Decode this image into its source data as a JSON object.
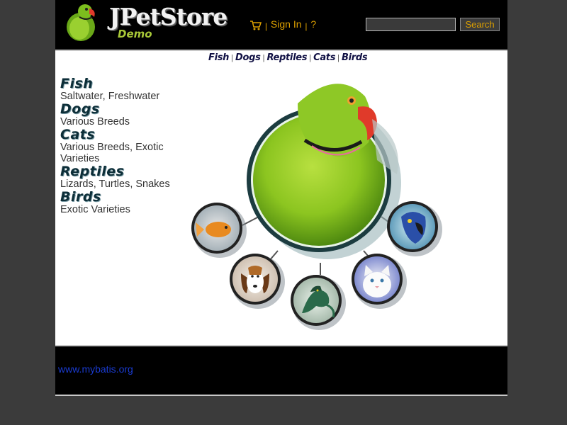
{
  "header": {
    "logo_title": "JPetStore",
    "logo_subtitle": "Demo",
    "cart_icon": "shopping-cart-icon",
    "separator": "|",
    "sign_in_label": "Sign In",
    "help_label": "?",
    "search": {
      "value": "",
      "button_label": "Search"
    },
    "colors": {
      "background": "#000000",
      "link": "#dda000"
    }
  },
  "quick_links": [
    "Fish",
    "Dogs",
    "Reptiles",
    "Cats",
    "Birds"
  ],
  "sidebar": {
    "categories": [
      {
        "name": "Fish",
        "description": "Saltwater, Freshwater"
      },
      {
        "name": "Dogs",
        "description": "Various Breeds"
      },
      {
        "name": "Cats",
        "description": "Various Breeds, Exotic Varieties"
      },
      {
        "name": "Reptiles",
        "description": "Lizards, Turtles, Snakes"
      },
      {
        "name": "Birds",
        "description": "Exotic Varieties"
      }
    ]
  },
  "splash": {
    "center": "parrot",
    "satellites": [
      "goldfish",
      "beagle",
      "iguana",
      "white-cat",
      "blue-macaw"
    ]
  },
  "footer": {
    "link": "www.mybatis.org"
  },
  "colors": {
    "page_background": "#3b3b3b",
    "content_background": "#ffffff",
    "footer_link": "#1a3bd0"
  }
}
